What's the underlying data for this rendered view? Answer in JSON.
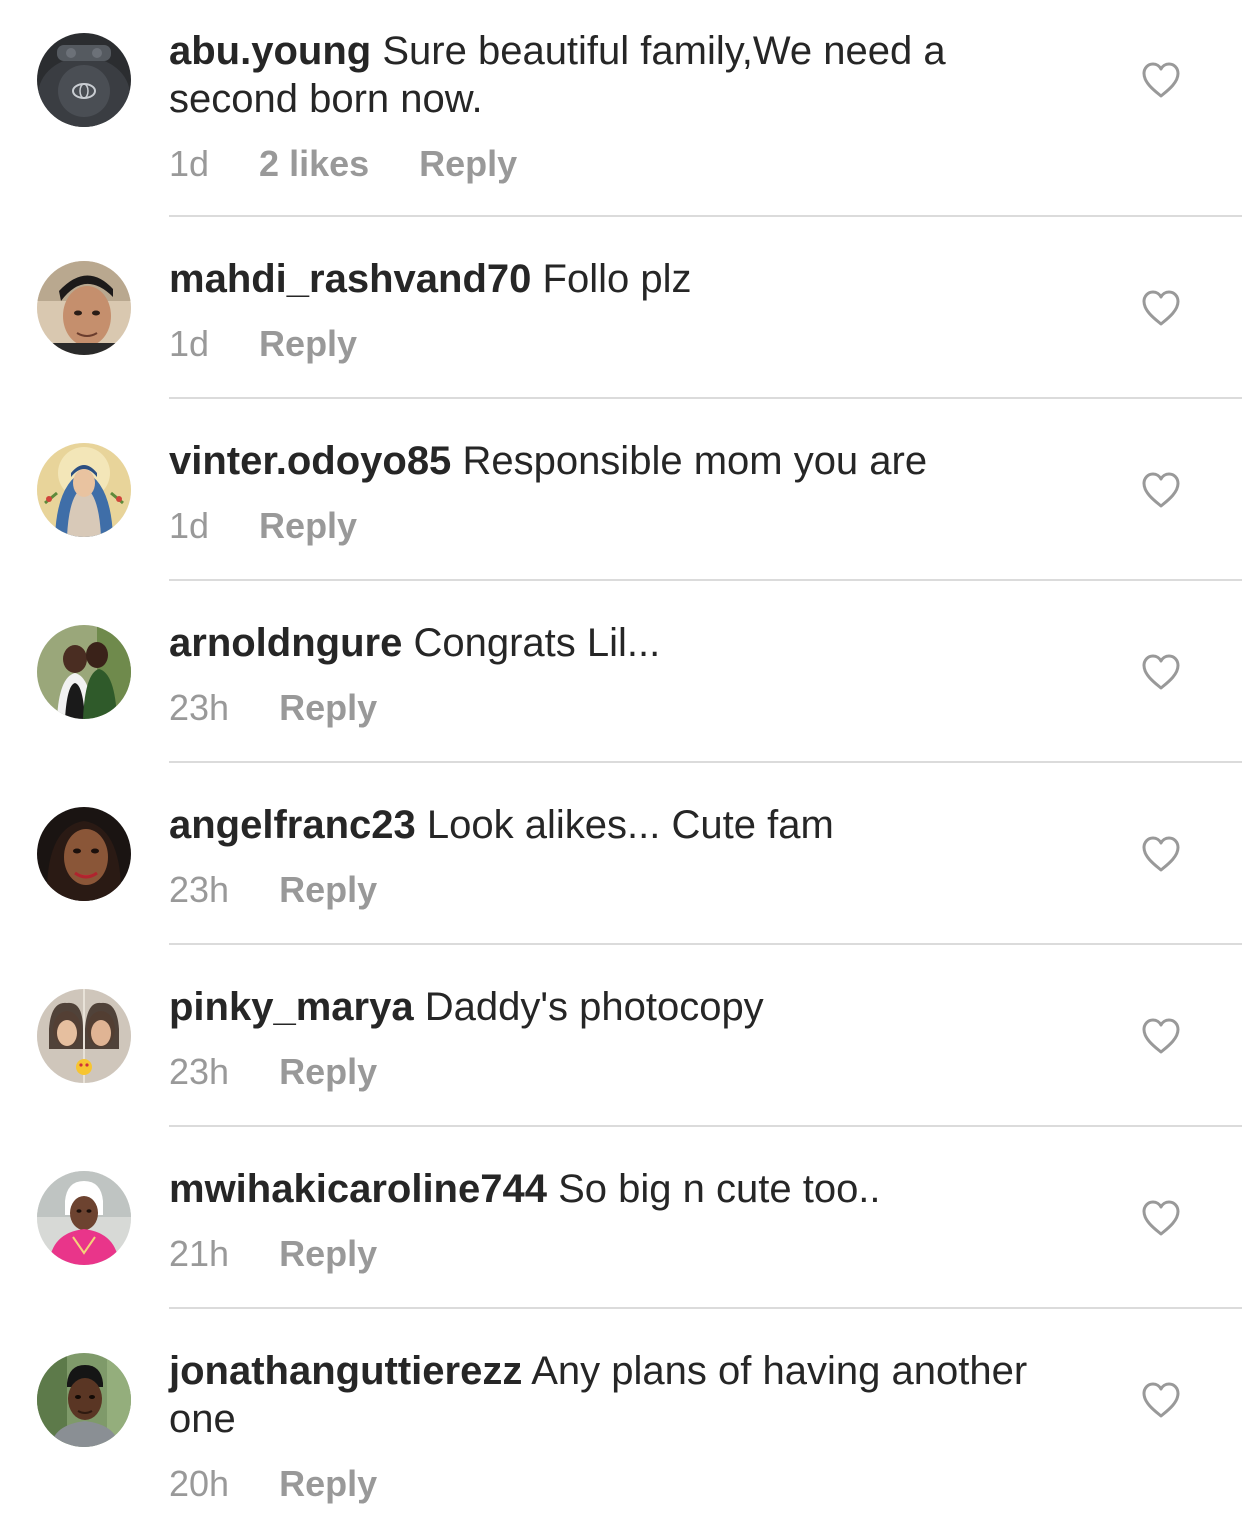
{
  "comments": [
    {
      "username": "abu.young",
      "text": "Sure beautiful family,We need a second born now.",
      "time": "1d",
      "likes": "2 likes",
      "reply": "Reply",
      "avatar_icon": "steering-wheel-photo"
    },
    {
      "username": "mahdi_rashvand70",
      "text": "Follo plz",
      "time": "1d",
      "likes": "",
      "reply": "Reply",
      "avatar_icon": "man-selfie-photo"
    },
    {
      "username": "vinter.odoyo85",
      "text": "Responsible mom you are",
      "time": "1d",
      "likes": "",
      "reply": "Reply",
      "avatar_icon": "virgin-mary-icon"
    },
    {
      "username": "arnoldngure",
      "text": "Congrats Lil...",
      "time": "23h",
      "likes": "",
      "reply": "Reply",
      "avatar_icon": "couple-photo"
    },
    {
      "username": "angelfranc23",
      "text": "Look alikes... Cute fam",
      "time": "23h",
      "likes": "",
      "reply": "Reply",
      "avatar_icon": "woman-portrait-photo"
    },
    {
      "username": "pinky_marya",
      "text": "Daddy's photocopy",
      "time": "23h",
      "likes": "",
      "reply": "Reply",
      "avatar_icon": "two-girls-photo"
    },
    {
      "username": "mwihakicaroline744",
      "text": "So big n cute too..",
      "time": "21h",
      "likes": "",
      "reply": "Reply",
      "avatar_icon": "woman-car-selfie-photo"
    },
    {
      "username": "jonathanguttierezz",
      "text": "Any plans of having another one",
      "time": "20h",
      "likes": "",
      "reply": "Reply",
      "avatar_icon": "young-man-photo"
    }
  ],
  "colors": {
    "text": "#262626",
    "meta": "#999999",
    "divider": "#dbdbdb",
    "heart_outline": "#999999"
  },
  "icons": {
    "like": "heart-outline-icon"
  }
}
